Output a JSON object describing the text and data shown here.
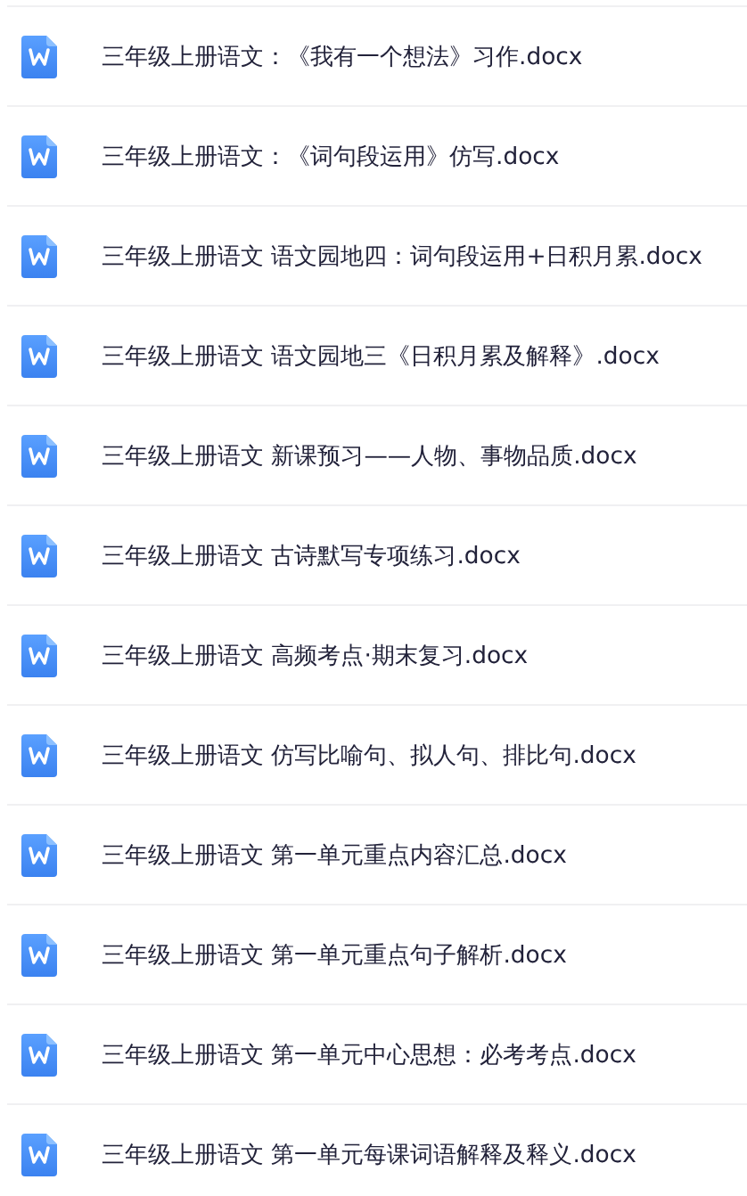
{
  "files": [
    {
      "name": "三年级上册语文：《我有一个想法》习作.docx"
    },
    {
      "name": "三年级上册语文：《词句段运用》仿写.docx"
    },
    {
      "name": "三年级上册语文 语文园地四：词句段运用+日积月累.docx"
    },
    {
      "name": "三年级上册语文 语文园地三《日积月累及解释》.docx"
    },
    {
      "name": "三年级上册语文 新课预习——人物、事物品质.docx"
    },
    {
      "name": "三年级上册语文 古诗默写专项练习.docx"
    },
    {
      "name": "三年级上册语文 高频考点·期末复习.docx"
    },
    {
      "name": "三年级上册语文 仿写比喻句、拟人句、排比句.docx"
    },
    {
      "name": "三年级上册语文 第一单元重点内容汇总.docx"
    },
    {
      "name": "三年级上册语文 第一单元重点句子解析.docx"
    },
    {
      "name": "三年级上册语文 第一单元中心思想：必考考点.docx"
    },
    {
      "name": "三年级上册语文 第一单元每课词语解释及释义.docx"
    }
  ]
}
